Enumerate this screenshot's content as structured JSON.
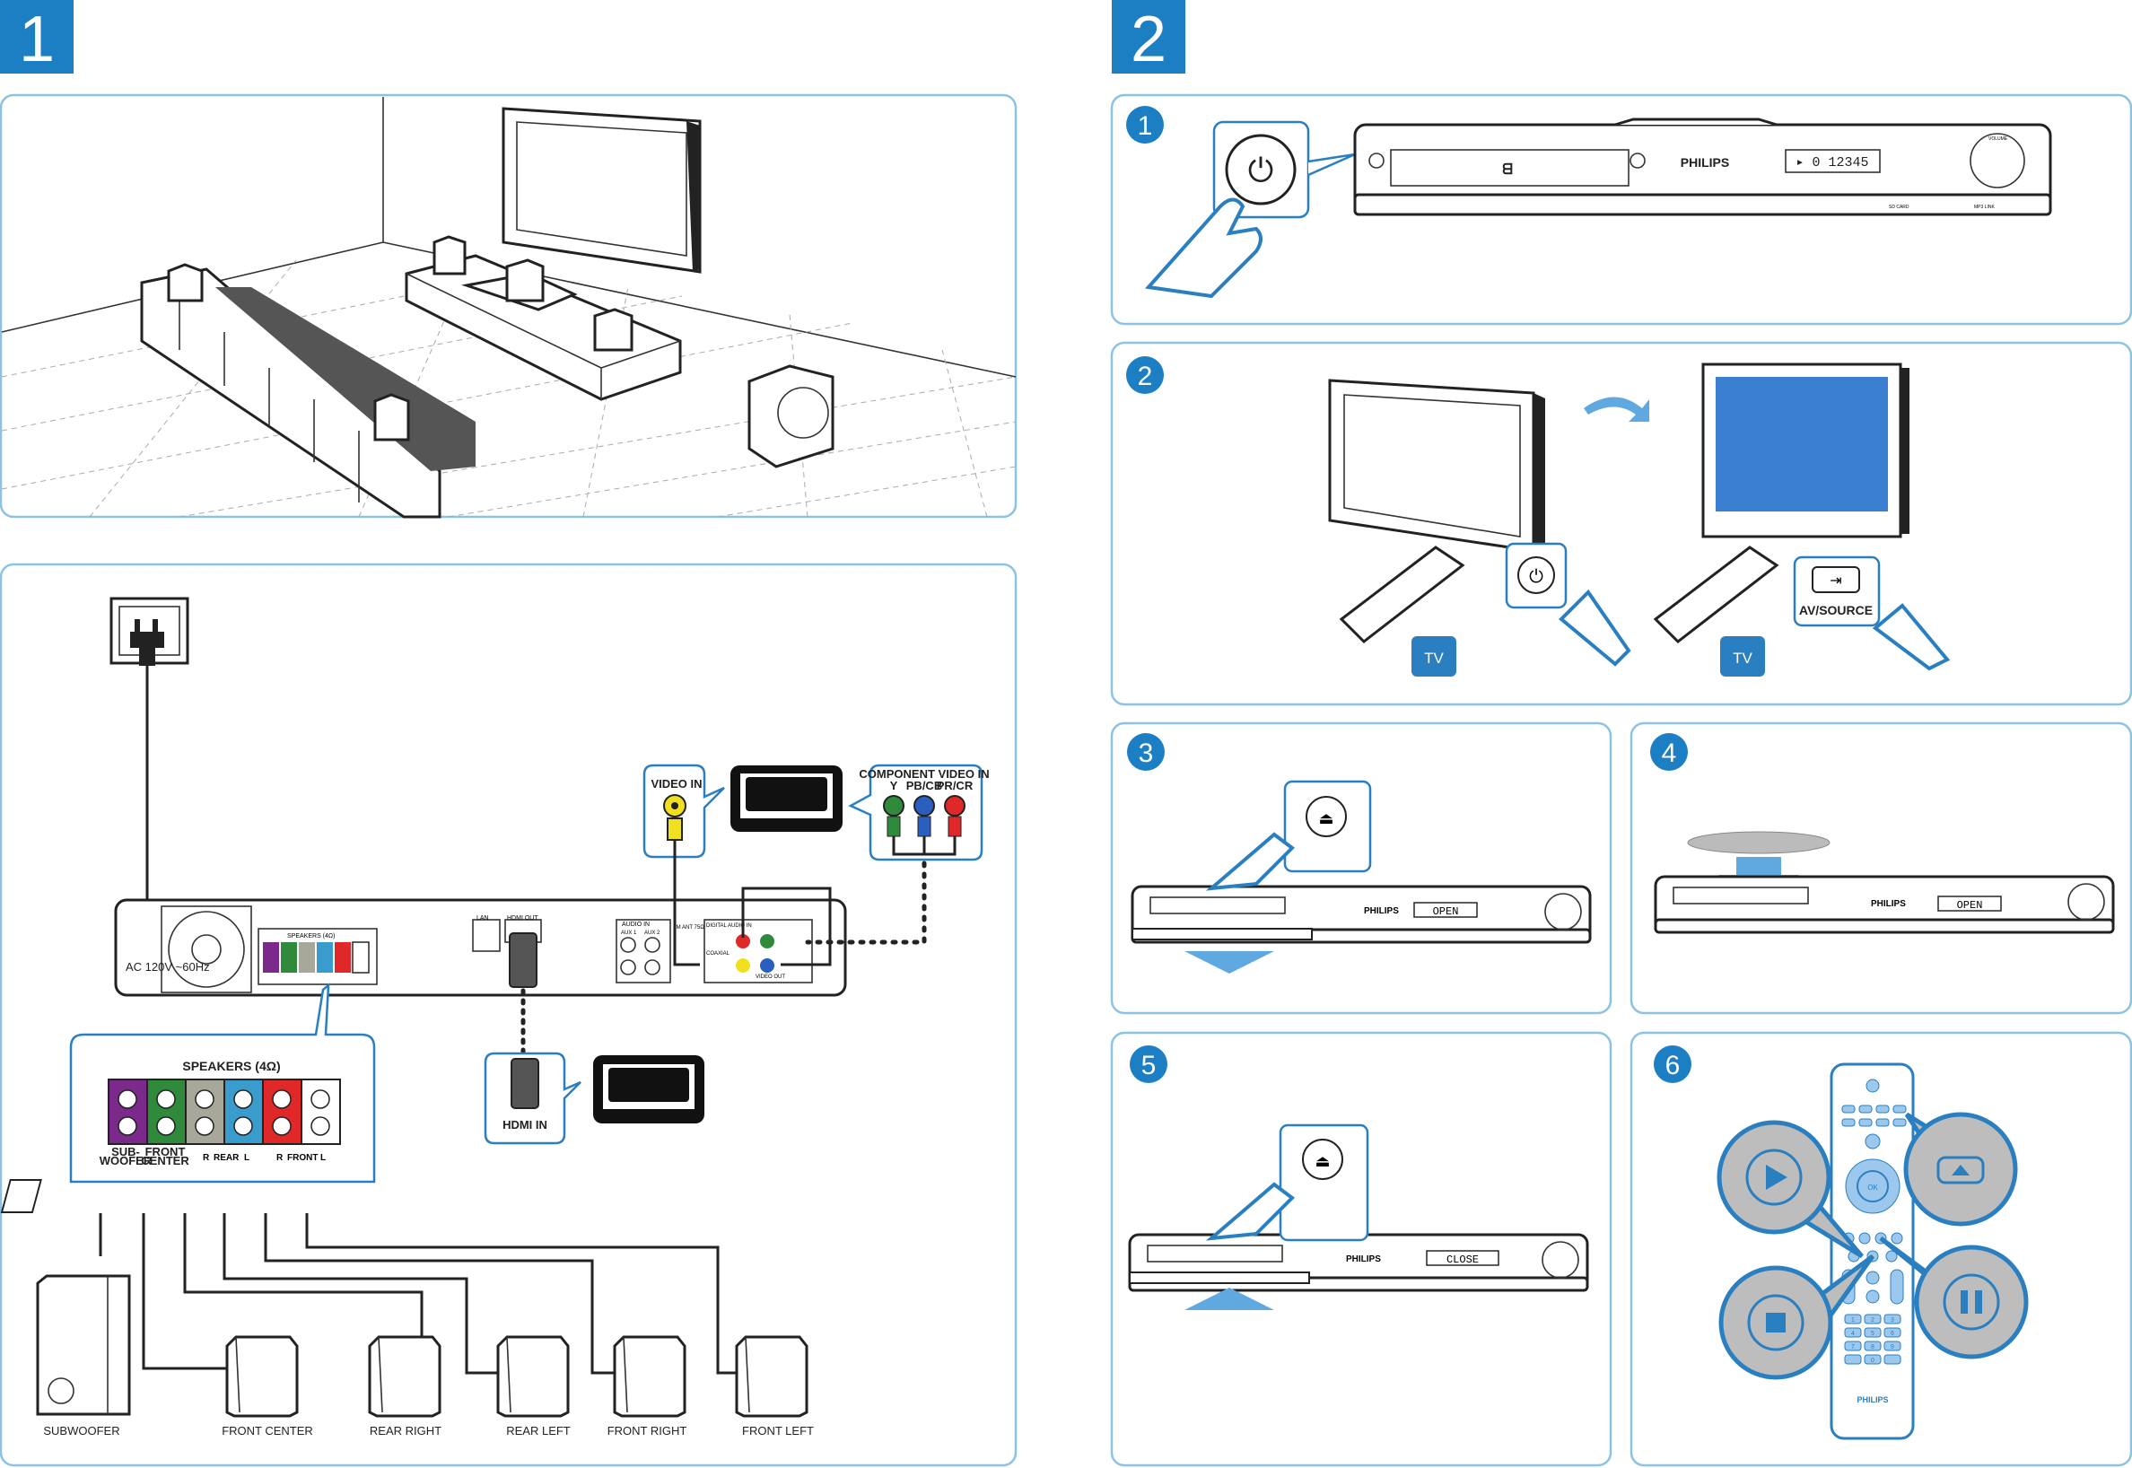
{
  "sections": [
    {
      "number": "1"
    },
    {
      "number": "2"
    }
  ],
  "connection": {
    "speakers_title": "SPEAKERS (4Ω)",
    "terminal_labels": {
      "subwoofer": "SUB-",
      "subwoofer2": "WOOFER",
      "center": "FRONT",
      "center2": "CENTER",
      "rear": "REAR",
      "front": "FRONT",
      "r": "R",
      "l": "L"
    },
    "speakers": [
      "SUBWOOFER",
      "FRONT CENTER",
      "REAR RIGHT",
      "REAR LEFT",
      "FRONT RIGHT",
      "FRONT LEFT"
    ],
    "speaker_colors": [
      "#7b2a8c",
      "#2f8a3c",
      "#a8a89a",
      "#3a9ccc",
      "#e02828",
      "#ffffff"
    ],
    "hdmi_in": "HDMI IN",
    "video_in": "VIDEO IN",
    "component": {
      "title": "COMPONENT VIDEO IN",
      "y": "Y",
      "pb": "PB/CB",
      "pr": "PR/CR"
    },
    "back_panel": {
      "ac": "AC 120V ~60Hz",
      "speakers": "SPEAKERS (4Ω)",
      "lan": "LAN",
      "hdmi_out": "HDMI OUT",
      "audio_in": "AUDIO IN",
      "aux1": "AUX 1",
      "aux2": "AUX 2",
      "fm": "FM ANT 75Ω",
      "digital": "DIGITAL AUDIO IN",
      "coaxial": "COAXIAL",
      "video_out": "VIDEO OUT",
      "component_out": "COMPONENT VIDEO OUT"
    }
  },
  "steps": [
    {
      "number": "1",
      "brand": "PHILIPS",
      "display": "▸ 0 12345",
      "volume": "VOLUME",
      "sd": "SD CARD",
      "mp3": "MP3 LINK"
    },
    {
      "number": "2",
      "av_source": "AV/SOURCE",
      "tv": "TV",
      "screen_color": "#3a7fd0"
    },
    {
      "number": "3",
      "brand": "PHILIPS",
      "display": "OPEN"
    },
    {
      "number": "4",
      "brand": "PHILIPS",
      "display": "OPEN"
    },
    {
      "number": "5",
      "brand": "PHILIPS",
      "display": "CLOSE"
    },
    {
      "number": "6",
      "brand": "PHILIPS",
      "ok": "OK",
      "keys": [
        "1",
        "2",
        "3",
        "4",
        "5",
        "6",
        "7",
        "8",
        "9",
        "0"
      ]
    }
  ],
  "colors": {
    "accent": "#1c7fc4",
    "panel_border": "#8cc3e2",
    "callout_gray": "#bdbdbd"
  }
}
